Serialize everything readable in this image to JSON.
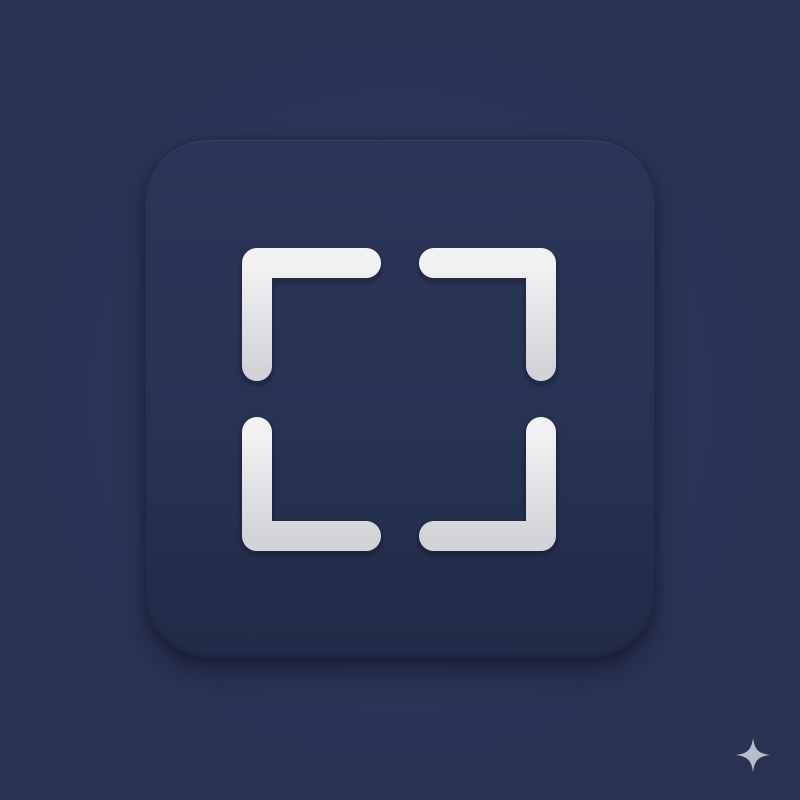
{
  "app_tile": {
    "icon": "fullscreen-frame-icon",
    "background_color": "#283253",
    "icon_color": "#e4e4e6"
  },
  "corner_mark": {
    "icon": "sparkle-icon",
    "color": "#c9cbd6"
  }
}
